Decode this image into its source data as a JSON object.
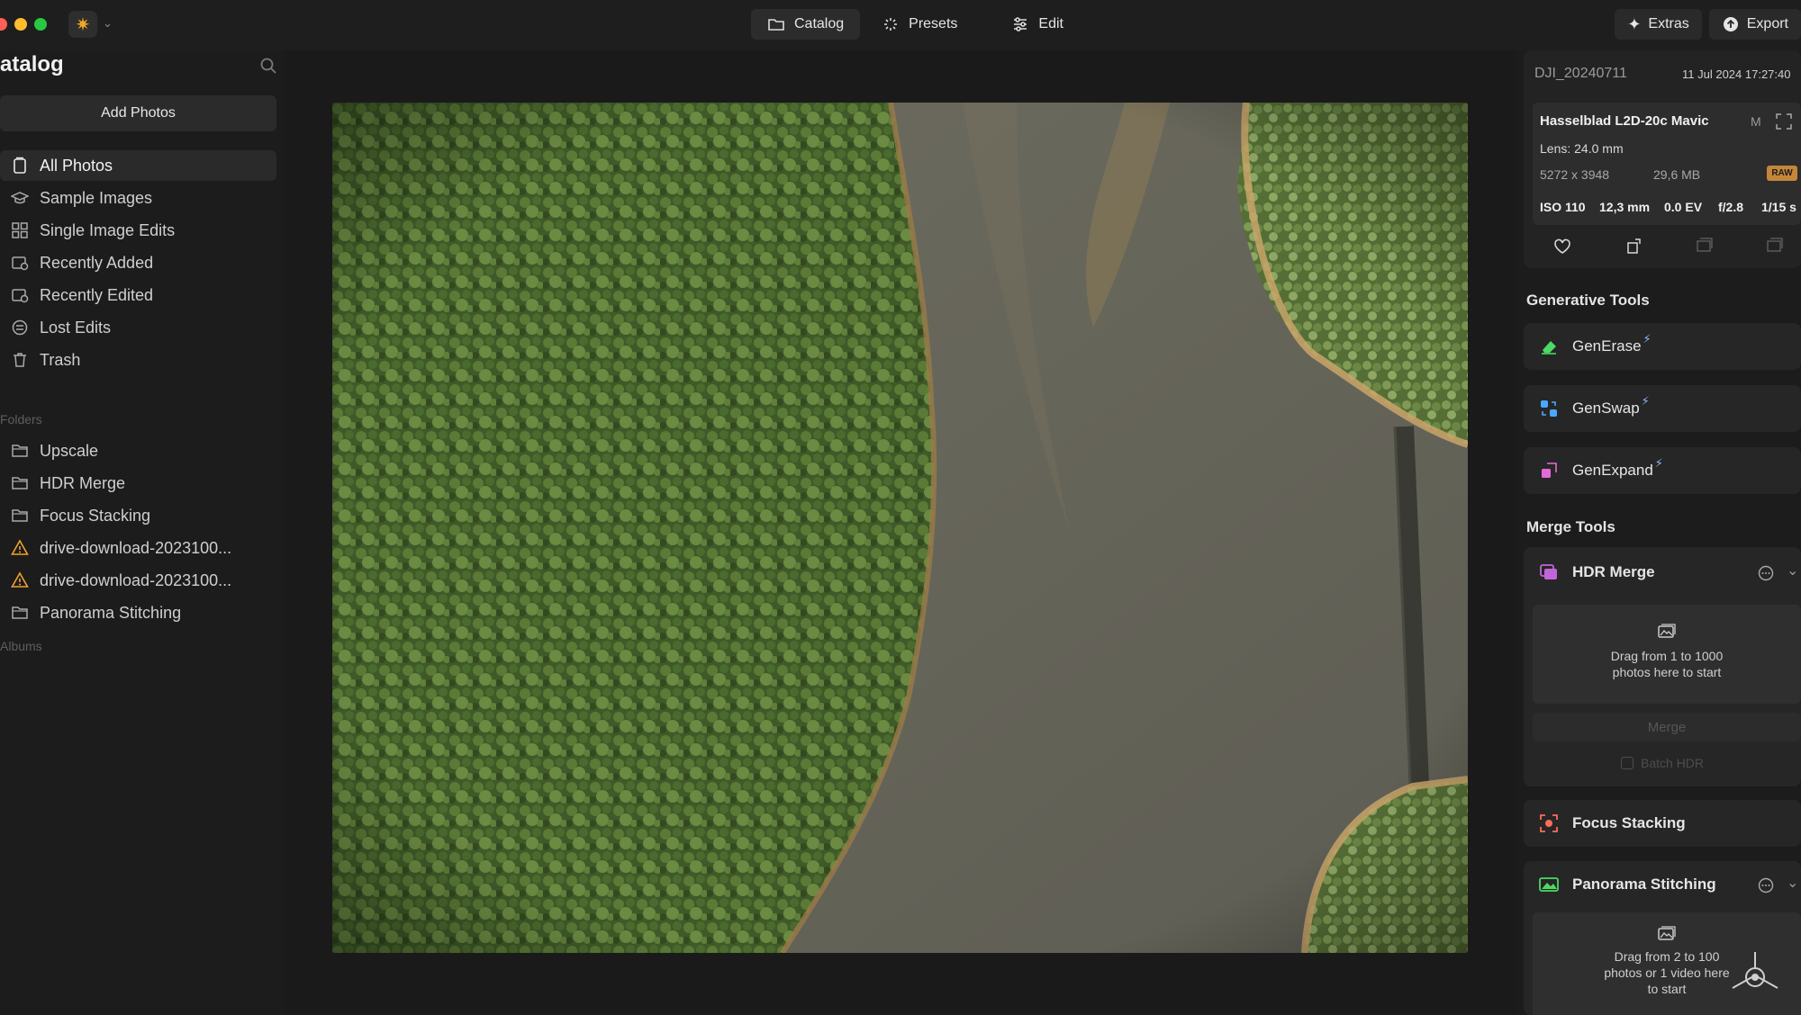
{
  "window": {
    "traffic_colors": {
      "close": "#ff5f57",
      "minimize": "#febc2e",
      "maximize": "#28c840"
    },
    "app_icon": "sun-icon"
  },
  "topnav": {
    "catalog": "Catalog",
    "presets": "Presets",
    "edit": "Edit"
  },
  "toolbar": {
    "extras": "Extras",
    "export": "Export"
  },
  "sidebar": {
    "title": "atalog",
    "add_photos": "Add Photos",
    "items": [
      {
        "label": "All Photos",
        "icon": "photos-icon"
      },
      {
        "label": "Sample Images",
        "icon": "graduation-cap-icon"
      },
      {
        "label": "Single Image Edits",
        "icon": "grid-icon"
      },
      {
        "label": "Recently Added",
        "icon": "recent-added-icon"
      },
      {
        "label": "Recently Edited",
        "icon": "recent-edited-icon"
      },
      {
        "label": "Lost Edits",
        "icon": "lost-edits-icon"
      },
      {
        "label": "Trash",
        "icon": "trash-icon"
      }
    ],
    "folders_label": "Folders",
    "folders": [
      {
        "label": "Upscale",
        "icon": "folder-icon"
      },
      {
        "label": "HDR Merge",
        "icon": "folder-icon"
      },
      {
        "label": "Focus Stacking",
        "icon": "folder-icon"
      },
      {
        "label": "drive-download-2023100...",
        "icon": "warning-icon"
      },
      {
        "label": "drive-download-2023100...",
        "icon": "warning-icon"
      },
      {
        "label": "Panorama Stitching",
        "icon": "folder-icon"
      }
    ],
    "albums_label": "Albums"
  },
  "photo_meta": {
    "filename": "DJI_20240711",
    "datetime": "11 Jul 2024 17:27:40",
    "camera": "Hasselblad L2D-20c Mavic",
    "mode": "M",
    "lens": "Lens: 24.0 mm",
    "dimensions": "5272 x 3948",
    "filesize": "29,6 MB",
    "format_badge": "RAW",
    "iso": "ISO 110",
    "focal": "12,3 mm",
    "ev": "0.0 EV",
    "aperture": "f/2.8",
    "shutter": "1/15 s"
  },
  "generative": {
    "title": "Generative Tools",
    "tools": [
      {
        "label": "GenErase",
        "icon": "eraser-icon",
        "color": "#4cd964"
      },
      {
        "label": "GenSwap",
        "icon": "swap-icon",
        "color": "#4aa8ff"
      },
      {
        "label": "GenExpand",
        "icon": "expand-icon",
        "color": "#e36ad6"
      }
    ]
  },
  "merge": {
    "title": "Merge Tools",
    "hdr": {
      "label": "HDR Merge",
      "drop_line1": "Drag from 1 to 1000",
      "drop_line2": "photos here to start",
      "merge_button": "Merge",
      "batch_label": "Batch HDR"
    },
    "focus": {
      "label": "Focus Stacking"
    },
    "panorama": {
      "label": "Panorama Stitching",
      "drop_line1": "Drag from 2 to 100",
      "drop_line2": "photos or 1 video here",
      "drop_line3": "to start"
    }
  }
}
